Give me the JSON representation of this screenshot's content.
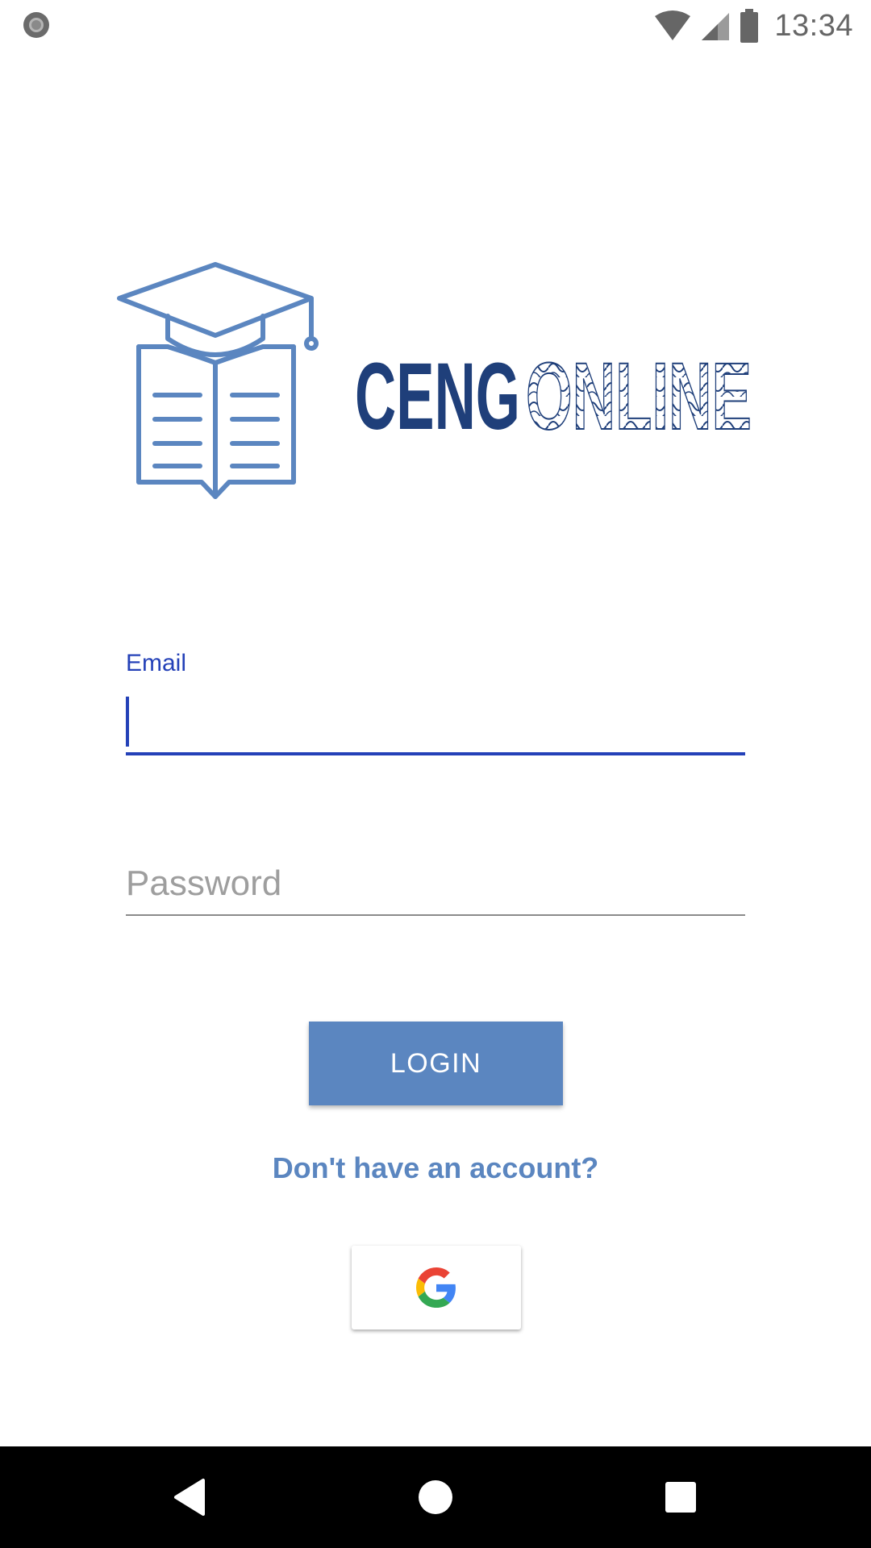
{
  "status_bar": {
    "time": "13:34",
    "icons": [
      "notification-circle-icon",
      "wifi-icon",
      "cell-signal-icon",
      "battery-icon"
    ]
  },
  "logo": {
    "text": "CENGONLINE",
    "text_part_dark": "CENG",
    "text_part_light": "ONLINE",
    "icon": "graduation-cap-book-icon",
    "colors": {
      "icon": "#5b86c0",
      "text": "#1f3f7a"
    }
  },
  "form": {
    "email": {
      "label": "Email",
      "value": ""
    },
    "password": {
      "placeholder": "Password",
      "value": ""
    }
  },
  "login_button": {
    "label": "LOGIN"
  },
  "signup_link": {
    "label": "Don't have an account?"
  },
  "google_button": {
    "icon": "google-g-icon"
  },
  "nav_bar": {
    "icons": [
      "back-icon",
      "home-icon",
      "recents-icon"
    ]
  },
  "colors": {
    "accent": "#2441b8",
    "button": "#5b86c0",
    "link": "#5b86c0"
  }
}
